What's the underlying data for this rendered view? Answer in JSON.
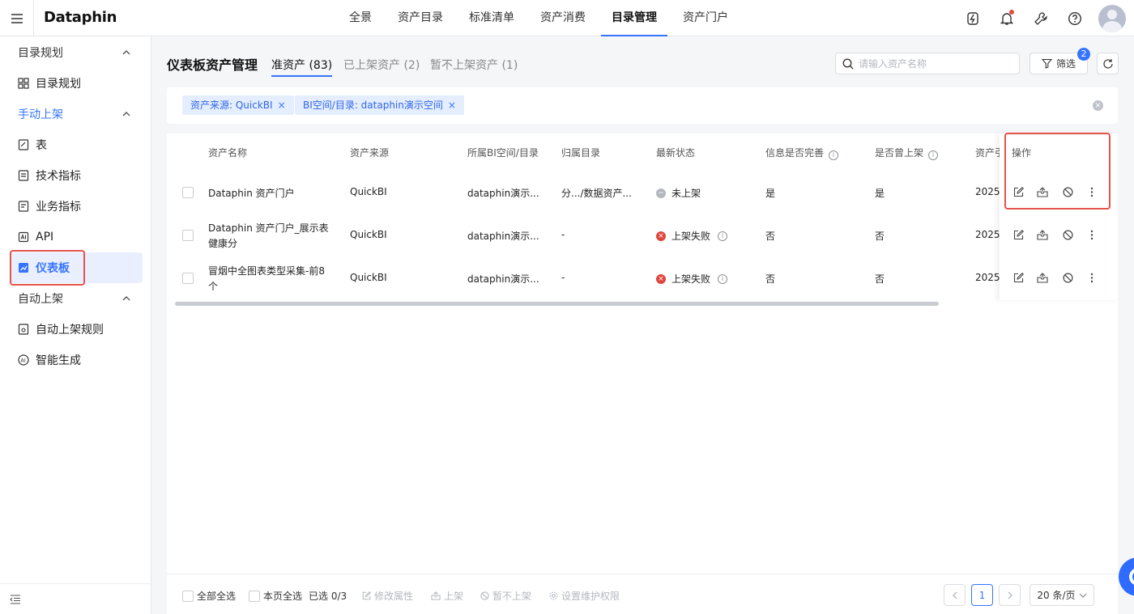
{
  "topbar": {
    "logo": "Dataphin",
    "nav": [
      "全景",
      "资产目录",
      "标准清单",
      "资产消费",
      "目录管理",
      "资产门户"
    ],
    "active_nav": "目录管理"
  },
  "sidebar": {
    "group1": "目录规划",
    "item_catalog_plan": "目录规划",
    "group2": "手动上架",
    "item_table": "表",
    "item_tech_metric": "技术指标",
    "item_biz_metric": "业务指标",
    "item_api": "API",
    "item_dashboard": "仪表板",
    "group3": "自动上架",
    "item_auto_rule": "自动上架规则",
    "item_smart_gen": "智能生成"
  },
  "header": {
    "title": "仪表板资产管理",
    "tab_quasi": "准资产 (83)",
    "tab_listed": "已上架资产 (2)",
    "tab_unlisted": "暂不上架资产 (1)",
    "search_placeholder": "请输入资产名称",
    "filter_label": "筛选",
    "filter_count": "2"
  },
  "chips": {
    "source": "资产来源: QuickBI",
    "bi_space": "BI空间/目录: dataphin演示空间",
    "remove": "×"
  },
  "table": {
    "headers": {
      "name": "资产名称",
      "source": "资产来源",
      "bi_space": "所属BI空间/目录",
      "catalog": "归属目录",
      "status": "最新状态",
      "complete": "信息是否完善",
      "ever_listed": "是否曾上架",
      "ref": "资产引",
      "ops": "操作"
    },
    "rows": [
      {
        "name": "Dataphin 资产门户",
        "name2": "",
        "source": "QuickBI",
        "bi_space": "dataphin演示...",
        "catalog": "分.../数据资产...",
        "status": "未上架",
        "complete": "是",
        "ever_listed": "是",
        "ref": "2025-"
      },
      {
        "name": "Dataphin 资产门户_展示表",
        "name2": "健康分",
        "source": "QuickBI",
        "bi_space": "dataphin演示...",
        "catalog": "-",
        "status": "上架失败",
        "complete": "否",
        "ever_listed": "否",
        "ref": "2025-"
      },
      {
        "name": "冒烟中全图表类型采集-前8",
        "name2": "个",
        "source": "QuickBI",
        "bi_space": "dataphin演示...",
        "catalog": "-",
        "status": "上架失败",
        "complete": "否",
        "ever_listed": "否",
        "ref": "2025-"
      }
    ]
  },
  "footer": {
    "select_all": "全部全选",
    "select_page": "本页全选",
    "selected": "已选 0/3",
    "edit_attr": "修改属性",
    "list": "上架",
    "unlist": "暂不上架",
    "maintain": "设置维护权限",
    "page": "1",
    "page_size": "20 条/页"
  },
  "colors": {
    "accent": "#3574ff",
    "highlight_box": "#e5534b",
    "fail": "#e0453c"
  }
}
